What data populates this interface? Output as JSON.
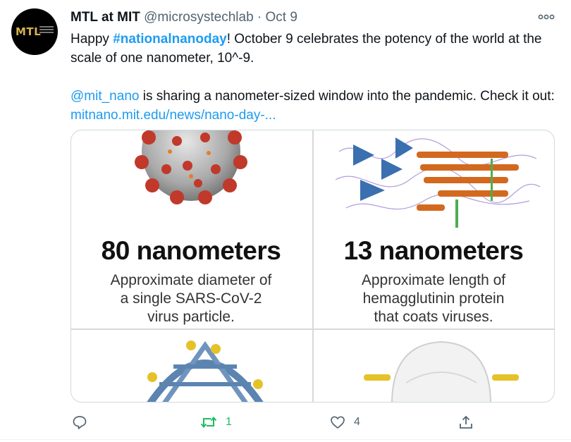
{
  "tweet": {
    "author_name": "MTL at MIT",
    "handle": "@microsystechlab",
    "separator": "·",
    "date": "Oct 9",
    "avatar_text": "MTL",
    "text": {
      "line1_prefix": "Happy ",
      "hashtag": "#nationalnanoday",
      "line1_suffix": "! October 9 celebrates the potency of the world at the scale of one nanometer, 10^-9.",
      "mention": "@mit_nano",
      "line2_middle": " is sharing a nanometer-sized window into the pandemic. Check it out: ",
      "url": "mitnano.mit.edu/news/nano-day-..."
    }
  },
  "media": {
    "cells": [
      {
        "title": "80 nanometers",
        "desc_lines": [
          "Approximate diameter of",
          "a single SARS-CoV-2",
          "virus particle."
        ]
      },
      {
        "title": "13 nanometers",
        "desc_lines": [
          "Approximate length of",
          "hemagglutinin protein",
          "that coats viruses."
        ]
      }
    ]
  },
  "actions": {
    "reply_count": "",
    "retweet_count": "1",
    "like_count": "4",
    "retweet_color": "#17bf63",
    "icon_color": "#536471"
  },
  "colors": {
    "link": "#1d9bf0",
    "virus_spike": "#c0392b",
    "protein_blue": "#3a6fb0",
    "protein_orange": "#d2691e",
    "avatar_gold": "#d6b24a"
  }
}
